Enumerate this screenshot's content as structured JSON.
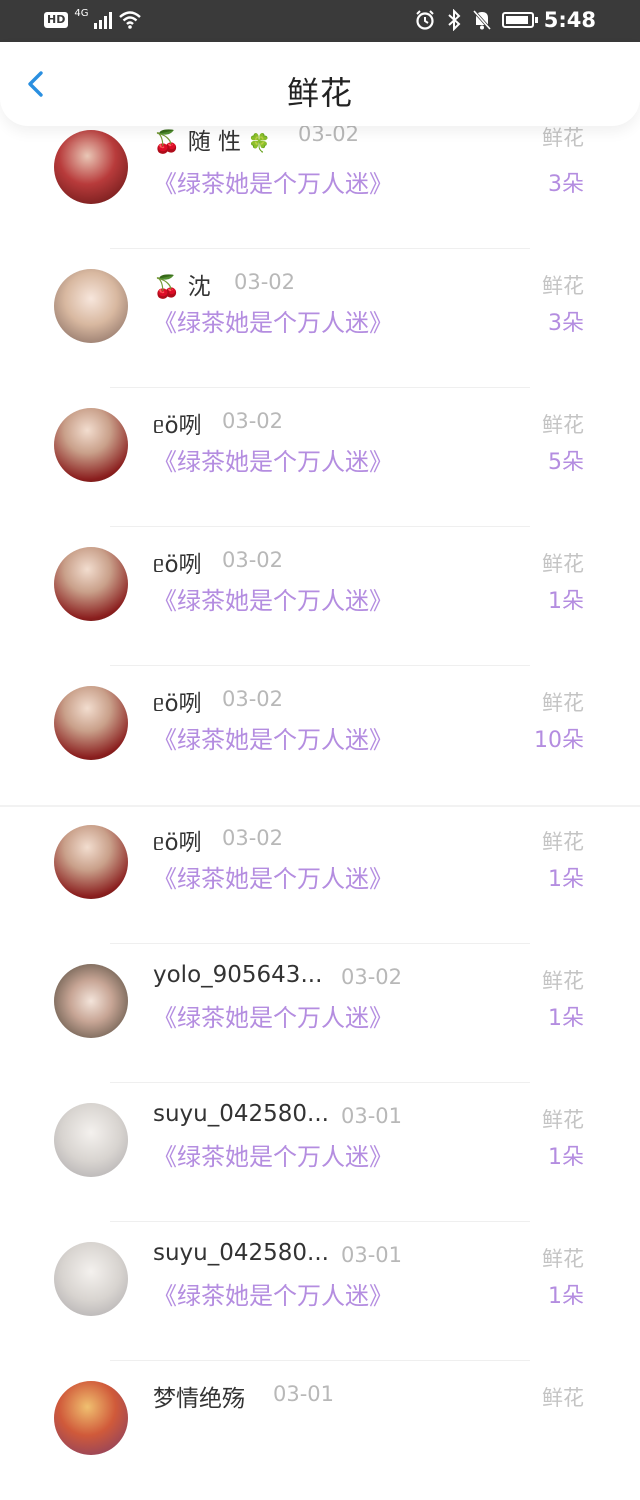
{
  "status": {
    "hd": "HD",
    "network": "4G",
    "time": "5:48"
  },
  "header": {
    "title": "鲜花"
  },
  "list": [
    {
      "name": "随 性",
      "prefix": "🍒",
      "suffix": "🍀",
      "date": "03-02",
      "book": "《绿茶她是个万人迷》",
      "type": "鲜花",
      "count": "3朵"
    },
    {
      "name": "沈",
      "prefix": "🍒",
      "date": "03-02",
      "book": "《绿茶她是个万人迷》",
      "type": "鲜花",
      "count": "3朵"
    },
    {
      "name": "ᥱö咧",
      "date": "03-02",
      "book": "《绿茶她是个万人迷》",
      "type": "鲜花",
      "count": "5朵"
    },
    {
      "name": "ᥱö咧",
      "date": "03-02",
      "book": "《绿茶她是个万人迷》",
      "type": "鲜花",
      "count": "1朵"
    },
    {
      "name": "ᥱö咧",
      "date": "03-02",
      "book": "《绿茶她是个万人迷》",
      "type": "鲜花",
      "count": "10朵"
    },
    {
      "name": "ᥱö咧",
      "date": "03-02",
      "book": "《绿茶她是个万人迷》",
      "type": "鲜花",
      "count": "1朵"
    },
    {
      "name": "yolo_905643...",
      "date": "03-02",
      "book": "《绿茶她是个万人迷》",
      "type": "鲜花",
      "count": "1朵"
    },
    {
      "name": "suyu_042580...",
      "date": "03-01",
      "book": "《绿茶她是个万人迷》",
      "type": "鲜花",
      "count": "1朵"
    },
    {
      "name": "suyu_042580...",
      "date": "03-01",
      "book": "《绿茶她是个万人迷》",
      "type": "鲜花",
      "count": "1朵"
    },
    {
      "name": "梦情绝殇",
      "date": "03-01",
      "book": "",
      "type": "鲜花",
      "count": ""
    }
  ]
}
